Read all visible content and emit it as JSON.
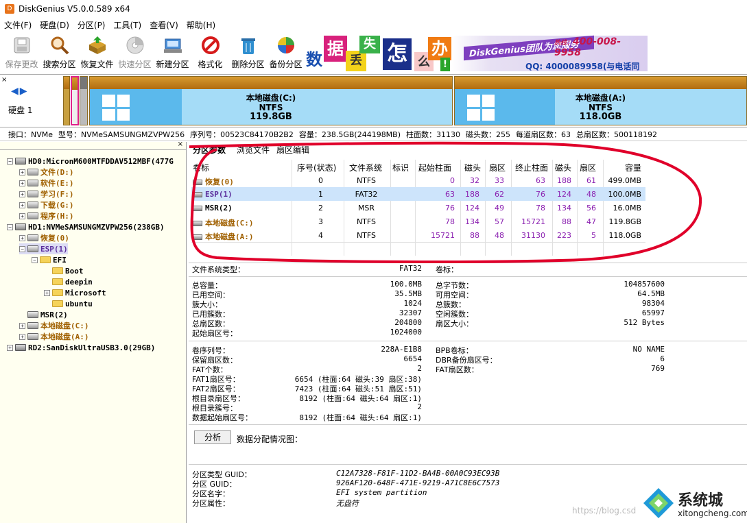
{
  "window": {
    "title": "DiskGenius V5.0.0.589 x64"
  },
  "menu": [
    "文件(F)",
    "硬盘(D)",
    "分区(P)",
    "工具(T)",
    "查看(V)",
    "帮助(H)"
  ],
  "toolbar": [
    {
      "label": "保存更改",
      "icon": "save-disk-icon",
      "enabled": false
    },
    {
      "label": "搜索分区",
      "icon": "magnifier-icon",
      "enabled": true
    },
    {
      "label": "恢复文件",
      "icon": "recover-box-icon",
      "enabled": true
    },
    {
      "label": "快速分区",
      "icon": "quick-partition-icon",
      "enabled": false
    },
    {
      "label": "新建分区",
      "icon": "new-partition-icon",
      "enabled": true
    },
    {
      "label": "格式化",
      "icon": "format-icon",
      "enabled": true
    },
    {
      "label": "删除分区",
      "icon": "trash-icon",
      "enabled": true
    },
    {
      "label": "备份分区",
      "icon": "backup-pie-icon",
      "enabled": true
    }
  ],
  "banner": {
    "chars": [
      "数",
      "据",
      "丢",
      "失",
      "怎",
      "么",
      "办",
      "!"
    ],
    "service": "DiskGenius团队为您服务",
    "phone_label": "热线：",
    "phone": "400-008-9958",
    "qq": "QQ: 4000089958(与电话同号)"
  },
  "diskmap": {
    "disk_label": "硬盘 1",
    "partitions": [
      {
        "name": "本地磁盘(C:)",
        "fs": "NTFS",
        "size": "119.8GB"
      },
      {
        "name": "本地磁盘(A:)",
        "fs": "NTFS",
        "size": "118.0GB"
      }
    ]
  },
  "infobar": {
    "interface": "接口：NVMe",
    "model": "型号：NVMeSAMSUNGMZVPW256",
    "serial": "序列号：00523C84170B2B2",
    "capacity": "容量：238.5GB(244198MB)",
    "cylinders": "柱面数：31130",
    "heads": "磁头数：255",
    "sectors_per_track": "每道扇区数：63",
    "total_sectors": "总扇区数：500118192"
  },
  "tree": [
    {
      "label": "HD0:MicronM600MTFDDAV512MBF(477G",
      "type": "disk",
      "level": 0,
      "expander": "−",
      "color": "black"
    },
    {
      "label": "文件(D:)",
      "type": "part",
      "level": 1,
      "expander": "+",
      "color": "orange"
    },
    {
      "label": "软件(E:)",
      "type": "part",
      "level": 1,
      "expander": "+",
      "color": "orange"
    },
    {
      "label": "学习(F:)",
      "type": "part",
      "level": 1,
      "expander": "+",
      "color": "orange"
    },
    {
      "label": "下载(G:)",
      "type": "part",
      "level": 1,
      "expander": "+",
      "color": "orange"
    },
    {
      "label": "程序(H:)",
      "type": "part",
      "level": 1,
      "expander": "+",
      "color": "orange"
    },
    {
      "label": "HD1:NVMeSAMSUNGMZVPW256(238GB)",
      "type": "disk",
      "level": 0,
      "expander": "−",
      "color": "black"
    },
    {
      "label": "恢复(0)",
      "type": "part",
      "level": 1,
      "expander": "+",
      "color": "orange"
    },
    {
      "label": "ESP(1)",
      "type": "part",
      "level": 1,
      "expander": "−",
      "color": "purple",
      "selected": true
    },
    {
      "label": "EFI",
      "type": "folder",
      "level": 2,
      "expander": "−",
      "color": "black"
    },
    {
      "label": "Boot",
      "type": "folder",
      "level": 3,
      "expander": "",
      "color": "black"
    },
    {
      "label": "deepin",
      "type": "folder",
      "level": 3,
      "expander": "",
      "color": "black"
    },
    {
      "label": "Microsoft",
      "type": "folder",
      "level": 3,
      "expander": "+",
      "color": "black"
    },
    {
      "label": "ubuntu",
      "type": "folder",
      "level": 3,
      "expander": "",
      "color": "black"
    },
    {
      "label": "MSR(2)",
      "type": "part",
      "level": 1,
      "expander": "",
      "color": "black"
    },
    {
      "label": "本地磁盘(C:)",
      "type": "part",
      "level": 1,
      "expander": "+",
      "color": "orange"
    },
    {
      "label": "本地磁盘(A:)",
      "type": "part",
      "level": 1,
      "expander": "+",
      "color": "orange"
    },
    {
      "label": "RD2:SanDiskUltraUSB3.0(29GB)",
      "type": "disk",
      "level": 0,
      "expander": "+",
      "color": "black"
    }
  ],
  "tabs": [
    "分区参数",
    "浏览文件",
    "扇区编辑"
  ],
  "table": {
    "headers": [
      "卷标",
      "序号(状态)",
      "文件系统",
      "标识",
      "起始柱面",
      "磁头",
      "扇区",
      "终止柱面",
      "磁头",
      "扇区",
      "容量"
    ],
    "rows": [
      {
        "label": "恢复(0)",
        "index": "0",
        "fs": "NTFS",
        "id": "",
        "start_cyl": "0",
        "start_head": "32",
        "start_sec": "33",
        "end_cyl": "63",
        "end_head": "188",
        "end_sec": "61",
        "size": "499.0MB",
        "color": "orange"
      },
      {
        "label": "ESP(1)",
        "index": "1",
        "fs": "FAT32",
        "id": "",
        "start_cyl": "63",
        "start_head": "188",
        "start_sec": "62",
        "end_cyl": "76",
        "end_head": "124",
        "end_sec": "48",
        "size": "100.0MB",
        "color": "purple",
        "selected": true
      },
      {
        "label": "MSR(2)",
        "index": "2",
        "fs": "MSR",
        "id": "",
        "start_cyl": "76",
        "start_head": "124",
        "start_sec": "49",
        "end_cyl": "78",
        "end_head": "134",
        "end_sec": "56",
        "size": "16.0MB",
        "color": "black"
      },
      {
        "label": "本地磁盘(C:)",
        "index": "3",
        "fs": "NTFS",
        "id": "",
        "start_cyl": "78",
        "start_head": "134",
        "start_sec": "57",
        "end_cyl": "15721",
        "end_head": "88",
        "end_sec": "47",
        "size": "119.8GB",
        "color": "orange"
      },
      {
        "label": "本地磁盘(A:)",
        "index": "4",
        "fs": "NTFS",
        "id": "",
        "start_cyl": "15721",
        "start_head": "88",
        "start_sec": "48",
        "end_cyl": "31130",
        "end_head": "223",
        "end_sec": "5",
        "size": "118.0GB",
        "color": "orange"
      }
    ]
  },
  "fs_info": {
    "fs_type_label": "文件系统类型：",
    "fs_type": "FAT32",
    "volume_label": "卷标：",
    "volume": "",
    "left": [
      {
        "k": "总容量：",
        "v": "100.0MB"
      },
      {
        "k": "已用空间：",
        "v": "35.5MB"
      },
      {
        "k": "簇大小：",
        "v": "1024"
      },
      {
        "k": "已用簇数：",
        "v": "32307"
      },
      {
        "k": "总扇区数：",
        "v": "204800"
      },
      {
        "k": "起始扇区号：",
        "v": "1024000"
      }
    ],
    "right": [
      {
        "k": "总字节数：",
        "v": "104857600"
      },
      {
        "k": "可用空间：",
        "v": "64.5MB"
      },
      {
        "k": "总簇数：",
        "v": "98304"
      },
      {
        "k": "空闲簇数：",
        "v": "65997"
      },
      {
        "k": "扇区大小：",
        "v": "512 Bytes"
      }
    ]
  },
  "fat_info": {
    "left": [
      {
        "k": "卷序列号：",
        "v": "228A-E1B8"
      },
      {
        "k": "保留扇区数：",
        "v": "6654"
      },
      {
        "k": "FAT个数：",
        "v": "2"
      },
      {
        "k": "FAT1扇区号：",
        "v": "6654 (柱面:64 磁头:39 扇区:38)"
      },
      {
        "k": "FAT2扇区号：",
        "v": "7423 (柱面:64 磁头:51 扇区:51)"
      },
      {
        "k": "根目录扇区号：",
        "v": "8192 (柱面:64 磁头:64 扇区:1)"
      },
      {
        "k": "根目录簇号：",
        "v": "2"
      },
      {
        "k": "数据起始扇区号：",
        "v": "8192 (柱面:64 磁头:64 扇区:1)"
      }
    ],
    "right": [
      {
        "k": "BPB卷标：",
        "v": "NO NAME"
      },
      {
        "k": "DBR备份扇区号：",
        "v": "6"
      },
      {
        "k": "FAT扇区数：",
        "v": "769"
      }
    ]
  },
  "analyze": {
    "button": "分析",
    "label": "数据分配情况图："
  },
  "guid_info": [
    {
      "k": "分区类型 GUID：",
      "v": "C12A7328-F81F-11D2-BA4B-00A0C93EC93B"
    },
    {
      "k": "分区 GUID：",
      "v": "926AF120-648F-471E-9219-A71C8E6C7573"
    },
    {
      "k": "分区名字：",
      "v": "EFI system partition"
    },
    {
      "k": "分区属性：",
      "v": "无盘符"
    }
  ],
  "watermark": {
    "text": "系统城",
    "url": "xitongcheng.com",
    "blog": "https://blog.csd"
  },
  "colors": {
    "annotation": "#e0002a",
    "selected_row": "#cde4fb",
    "tree_bg": "#fffff0",
    "partition_bar": "#a5dcf7"
  }
}
